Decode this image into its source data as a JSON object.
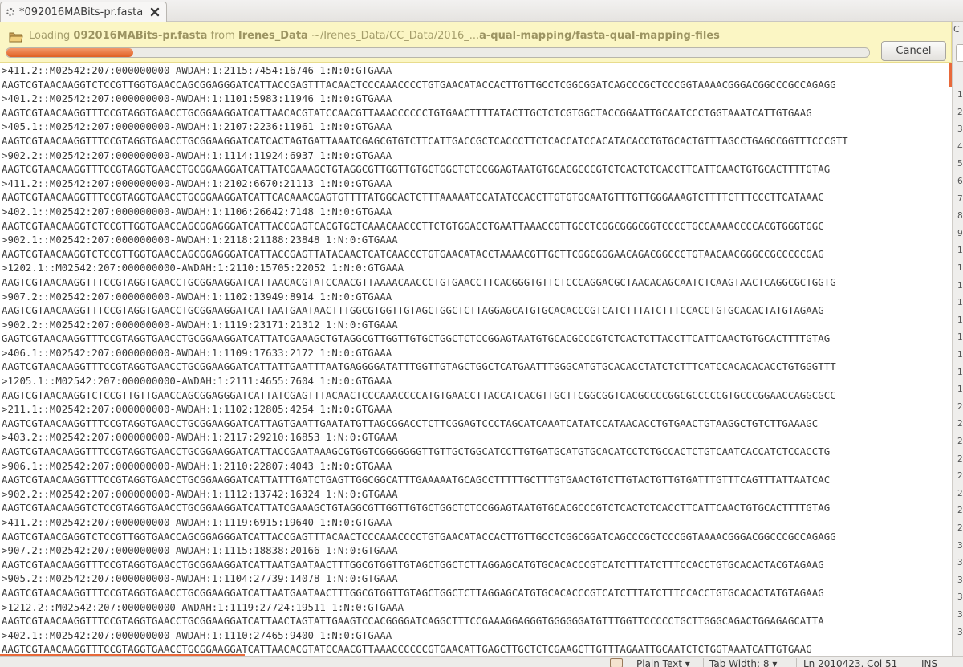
{
  "tab": {
    "title": "*092016MABits-pr.fasta",
    "close_icon": "close-x-icon"
  },
  "infobar": {
    "loading": "Loading ",
    "filename": "092016MABits-pr.fasta",
    "from": " from ",
    "folder": "Irenes_Data",
    "path_prefix": " ~/Irenes_Data/CC_Data/2016_...",
    "path_bold": "a-qual-mapping/fasta-qual-mapping-files",
    "progress_fraction": 0.147,
    "cancel_label": "Cancel"
  },
  "editor": {
    "lines": [
      ">411.2::M02542:207:000000000-AWDAH:1:2115:7454:16746 1:N:0:GTGAAA",
      "AAGTCGTAACAAGGTCTCCGTTGGTGAACCAGCGGAGGGATCATTACCGAGTTTACAACTCCCAAACCCCTGTGAACATACCACTTGTTGCCTCGGCGGATCAGCCCGCTCCCGGTAAAACGGGACGGCCCGCCAGAGG",
      ">401.2::M02542:207:000000000-AWDAH:1:1101:5983:11946 1:N:0:GTGAAA",
      "AAGTCGTAACAAGGTTTCCGTAGGTGAACCTGCGGAAGGATCATTAACACGTATCCAACGTTAAACCCCCCTGTGAACTTTTATACTTGCTCTCGTGGCTACCGGAATTGCAATCCCTGGTAAATCATTGTGAAG",
      ">405.1::M02542:207:000000000-AWDAH:1:2107:2236:11961 1:N:0:GTGAAA",
      "AAGTCGTAACAAGGTTTCCGTAGGTGAACCTGCGGAAGGATCATCACTAGTGATTAAATCGAGCGTGTCTTCATTGACCGCTCACCCTTCTCACCATCCACATACACCTGTGCACTGTTTAGCCTGAGCCGGTTTCCCGTT",
      ">902.2::M02542:207:000000000-AWDAH:1:1114:11924:6937 1:N:0:GTGAAA",
      "AAGTCGTAACAAGGTTTCCGTAGGTGAACCTGCGGAAGGATCATTATCGAAAGCTGTAGGCGTTGGTTGTGCTGGCTCTCCGGAGTAATGTGCACGCCCGTCTCACTCTCACCTTCATTCAACTGTGCACTTTTGTAG",
      ">411.2::M02542:207:000000000-AWDAH:1:2102:6670:21113 1:N:0:GTGAAA",
      "AAGTCGTAACAAGGTTTCCGTAGGTGAACCTGCGGAAGGATCATTCACAAACGAGTGTTTTATGGCACTCTTTAAAAATCCATATCCACCTTGTGTGCAATGTTTGTTGGGAAAGTCTTTTCTTTCCCTTCATAAAC",
      ">402.1::M02542:207:000000000-AWDAH:1:1106:26642:7148 1:N:0:GTGAAA",
      "AAGTCGTAACAAGGTCTCCGTTGGTGAACCAGCGGAGGGATCATTACCGAGTCACGTGCTCAAACAACCCTTCTGTGGACCTGAATTAAACCGTTGCCTCGGCGGGCGGTCCCCTGCCAAAACCCCACGTGGGTGGC",
      ">902.1::M02542:207:000000000-AWDAH:1:2118:21188:23848 1:N:0:GTGAAA",
      "AAGTCGTAACAAGGTCTCCGTTGGTGAACCAGCGGAGGGATCATTACCGAGTTATACAACTCATCAACCCTGTGAACATACCTAAAACGTTGCTTCGGCGGGAACAGACGGCCCTGTAACAACGGGCCGCCCCCGAG",
      ">1202.1::M02542:207:000000000-AWDAH:1:2110:15705:22052 1:N:0:GTGAAA",
      "AAGTCGTAACAAGGTTTCCGTAGGTGAACCTGCGGAAGGATCATTAACACGTATCCAACGTTAAAACAACCCTGTGAACCTTCACGGGTGTTCTCCCAGGACGCTAACACAGCAATCTCAAGTAACTCAGGCGCTGGTG",
      ">907.2::M02542:207:000000000-AWDAH:1:1102:13949:8914 1:N:0:GTGAAA",
      "AAGTCGTAACAAGGTTTCCGTAGGTGAACCTGCGGAAGGATCATTAATGAATAACTTTGGCGTGGTTGTAGCTGGCTCTTAGGAGCATGTGCACACCCGTCATCTTTATCTTTCCACCTGTGCACACTATGTAGAAG",
      ">902.2::M02542:207:000000000-AWDAH:1:1119:23171:21312 1:N:0:GTGAAA",
      "GAGTCGTAACAAGGTTTCCGTAGGTGAACCTGCGGAAGGATCATTATCGAAAGCTGTAGGCGTTGGTTGTGCTGGCTCTCCGGAGTAATGTGCACGCCCGTCTCACTCTTACCTTCATTCAACTGTGCACTTTTGTAG",
      ">406.1::M02542:207:000000000-AWDAH:1:1109:17633:2172 1:N:0:GTGAAA",
      "AAGTCGTAACAAGGTTTCCGTAGGTGAACCTGCGGAAGGATCATTATTGAATTTAATGAGGGGATATTTGGTTGTAGCTGGCTCATGAATTTGGGCATGTGCACACCTATCTCTTTCATCCACACACACCTGTGGGTTT",
      ">1205.1::M02542:207:000000000-AWDAH:1:2111:4655:7604 1:N:0:GTGAAA",
      "AAGTCGTAACAAGGTCTCCGTTGTTGAACCAGCGGAGGGATCATTATCGAGTTTACAACTCCCAAACCCCATGTGAACCTTACCATCACGTTGCTTCGGCGGTCACGCCCCGGCGCCCCCGTGCCCGGAACCAGGCGCC",
      ">211.1::M02542:207:000000000-AWDAH:1:1102:12805:4254 1:N:0:GTGAAA",
      "AAGTCGTAACAAGGTTTCCGTAGGTGAACCTGCGGAAGGATCATTAGTGAATTGAATATGTTAGCGGACCTCTTCGGAGTCCCTAGCATCAAATCATATCCATAACACCTGTGAACTGTAAGGCTGTCTTGAAAGC",
      ">403.2::M02542:207:000000000-AWDAH:1:2117:29210:16853 1:N:0:GTGAAA",
      "AAGTCGTAACAAGGTTTCCGTAGGTGAACCTGCGGAAGGATCATTACCGAATAAAGCGTGGTCGGGGGGGTTGTTGCTGGCATCCTTGTGATGCATGTGCACATCCTCTGCCACTCTGTCAATCACCATCTCCACCTG",
      ">906.1::M02542:207:000000000-AWDAH:1:2110:22807:4043 1:N:0:GTGAAA",
      "AAGTCGTAACAAGGTTTCCGTAGGTGAACCTGCGGAAGGATCATTATTTGATCTGAGTTGGCGGCATTTGAAAAATGCAGCCTTTTTGCTTTGTGAACTGTCTTGTACTGTTGTGATTTGTTTCAGTTTATTAATCAC",
      ">902.2::M02542:207:000000000-AWDAH:1:1112:13742:16324 1:N:0:GTGAAA",
      "AAGTCGTAACAAGGTCTCCGTAGGTGAACCTGCGGAAGGATCATTATCGAAAGCTGTAGGCGTTGGTTGTGCTGGCTCTCCGGAGTAATGTGCACGCCCGTCTCACTCTCACCTTCATTCAACTGTGCACTTTTGTAG",
      ">411.2::M02542:207:000000000-AWDAH:1:1119:6915:19640 1:N:0:GTGAAA",
      "AAGTCGTAACGAGGTCTCCGTTGGTGAACCAGCGGAGGGATCATTACCGAGTTTACAACTCCCAAACCCCTGTGAACATACCACTTGTTGCCTCGGCGGATCAGCCCGCTCCCGGTAAAACGGGACGGCCCGCCAGAGG",
      ">907.2::M02542:207:000000000-AWDAH:1:1115:18838:20166 1:N:0:GTGAAA",
      "AAGTCGTAACAAGGTTTCCGTAGGTGAACCTGCGGAAGGATCATTAATGAATAACTTTGGCGTGGTTGTAGCTGGCTCTTAGGAGCATGTGCACACCCGTCATCTTTATCTTTCCACCTGTGCACACTACGTAGAAG",
      ">905.2::M02542:207:000000000-AWDAH:1:1104:27739:14078 1:N:0:GTGAAA",
      "AAGTCGTAACAAGGTTTCCGTAGGTGAACCTGCGGAAGGATCATTAATGAATAACTTTGGCGTGGTTGTAGCTGGCTCTTAGGAGCATGTGCACACCCGTCATCTTTATCTTTCCACCTGTGCACACTATGTAGAAG",
      ">1212.2::M02542:207:000000000-AWDAH:1:1119:27724:19511 1:N:0:GTGAAA",
      "AAGTCGTAACAAGGTTTCCGTAGGTGAACCTGCGGAAGGATCATTAACTAGTATTGAAGTCCACGGGGATCAGGCTTTCCGAAAGGAGGGTGGGGGGATGTTTGGTTCCCCCTGCTTGGGCAGACTGGAGAGCATTA",
      ">402.1::M02542:207:000000000-AWDAH:1:1110:27465:9400 1:N:0:GTGAAA",
      "AAGTCGTAACAAGGTTTCCGTAGGTGAACCTGCGGAAGGATCATTAACACGTATCCAACGTTAAACCCCCCGTGAACATTGAGCTTGCTCTCGAAGCTTGTTTAGAATTGCAATCTCTGGTAAATCATTGTGAAG"
    ]
  },
  "sidepanel": {
    "top_label": "C",
    "gutter_numbers": [
      "1",
      "2",
      "3",
      "4",
      "5",
      "6",
      "7",
      "8",
      "9",
      "1",
      "1",
      "1",
      "1",
      "1",
      "1",
      "1",
      "1",
      "1",
      "2",
      "2",
      "2",
      "2",
      "2",
      "2",
      "2",
      "2",
      "3",
      "3",
      "3",
      "3",
      "3",
      "3"
    ]
  },
  "statusbar": {
    "language": "Plain Text",
    "tab_width": "Tab Width: 8",
    "position": "Ln 2010423, Col 51",
    "mode": "INS",
    "language_icon": "document-icon"
  },
  "colors": {
    "accent": "#e05f23",
    "infobar_bg": "#fbf6c4",
    "text": "#3a3a3a"
  }
}
